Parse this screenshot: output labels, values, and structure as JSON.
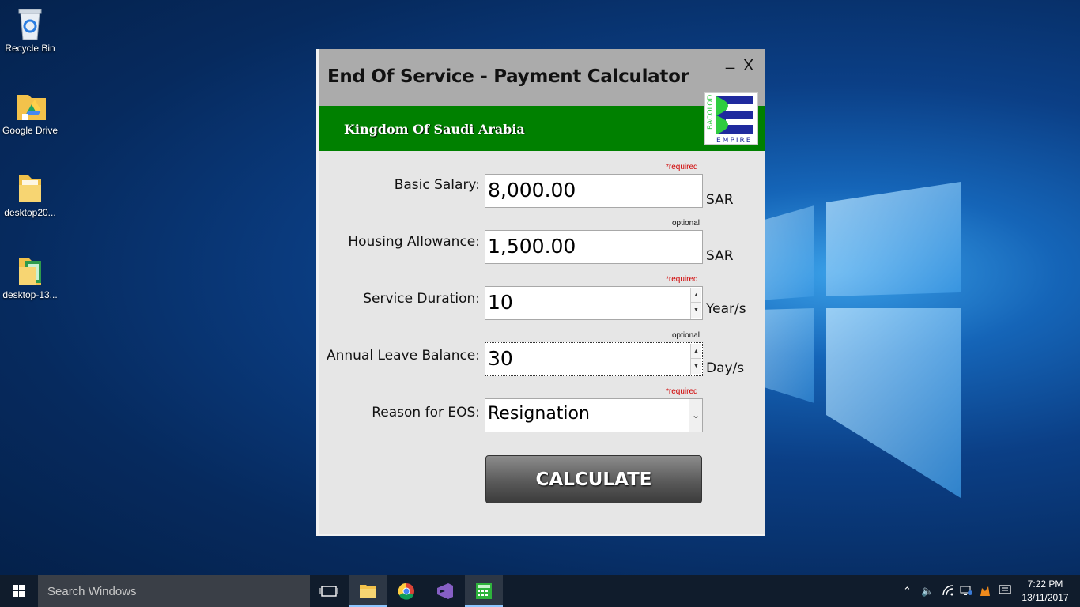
{
  "desktop": {
    "icons": [
      {
        "label": "Recycle Bin"
      },
      {
        "label": "Google Drive"
      },
      {
        "label": "desktop20..."
      },
      {
        "label": "desktop-13..."
      }
    ]
  },
  "window": {
    "title": "End Of Service - Payment Calculator",
    "minimize_label": "_",
    "close_label": "X",
    "banner_text": "Kingdom Of Saudi Arabia",
    "logo_text_vertical": "BACOLOD",
    "logo_text_bottom": "EMPIRE",
    "logo_letter": "E"
  },
  "form": {
    "basic_salary": {
      "label": "Basic Salary:",
      "value": "8,000.00",
      "unit": "SAR",
      "tag": "*required"
    },
    "housing": {
      "label": "Housing Allowance:",
      "value": "1,500.00",
      "unit": "SAR",
      "tag": "optional"
    },
    "duration": {
      "label": "Service Duration:",
      "value": "10",
      "unit": "Year/s",
      "tag": "*required"
    },
    "leave": {
      "label": "Annual Leave Balance:",
      "value": "30",
      "unit": "Day/s",
      "tag": "optional"
    },
    "reason": {
      "label": "Reason for EOS:",
      "value": "Resignation",
      "tag": "*required"
    },
    "calculate_label": "CALCULATE"
  },
  "taskbar": {
    "search_placeholder": "Search Windows",
    "time": "7:22 PM",
    "date": "13/11/2017"
  },
  "colors": {
    "banner": "#008000",
    "titlebar": "#ababab",
    "required": "#d00000",
    "taskbar": "#101c2c"
  }
}
